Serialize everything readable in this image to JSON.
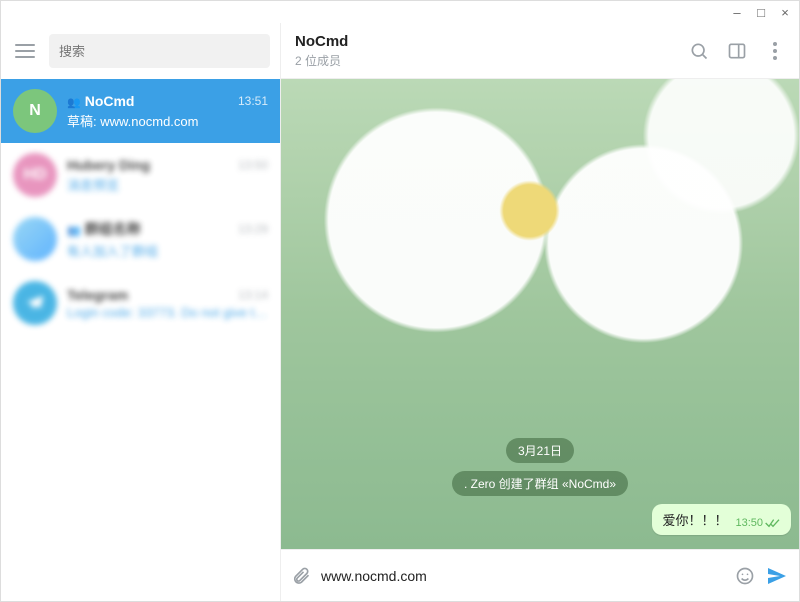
{
  "window": {
    "minimize": "–",
    "maximize": "□",
    "close": "×"
  },
  "sidebar": {
    "search_placeholder": "搜索",
    "chats": [
      {
        "avatar_letter": "N",
        "avatar_class": "av-n",
        "group": true,
        "name": "NoCmd",
        "time": "13:51",
        "preview": "草稿: www.nocmd.com",
        "selected": true
      },
      {
        "avatar_letter": "HD",
        "avatar_class": "av-hd",
        "group": false,
        "name": "Hubery Ding",
        "time": "13:50",
        "preview": "消息预览",
        "selected": false,
        "blurred": true
      },
      {
        "avatar_letter": "",
        "avatar_class": "av-img",
        "group": true,
        "name": "群组名称",
        "time": "13:29",
        "preview": "有人加入了群组",
        "selected": false,
        "blurred": true
      },
      {
        "avatar_letter": "",
        "avatar_class": "av-tg",
        "group": false,
        "name": "Telegram",
        "time": "13:14",
        "preview": "Login code: 33773. Do not give thi…",
        "selected": false,
        "blurred": true
      }
    ]
  },
  "header": {
    "title": "NoCmd",
    "subtitle": "2 位成员"
  },
  "chat": {
    "date_pill": "3月21日",
    "system_pill": ". Zero 创建了群组 «NoCmd»",
    "outgoing": {
      "text": "爱你！！！",
      "time": "13:50"
    }
  },
  "composer": {
    "value": "www.nocmd.com"
  }
}
